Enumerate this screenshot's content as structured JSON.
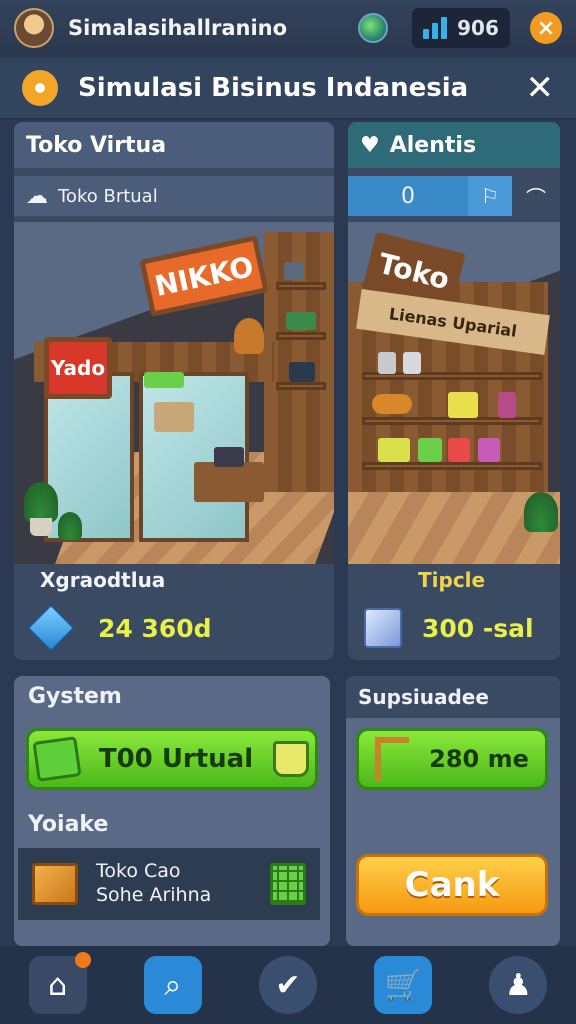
{
  "app": {
    "name": "Simalasihallranino",
    "stat_value": "906"
  },
  "titlebar": {
    "title": "Simulasi Bisinus Indanesia"
  },
  "left_panel": {
    "header": "Toko Virtua",
    "sub_label": "Toko Brtual",
    "sign_text": "NIKKO",
    "side_sign_text": "Yado",
    "caption": "Xgraodtlua",
    "value": "24 360d"
  },
  "right_panel": {
    "header": "Alentis",
    "counter": "0",
    "sign_top": "Toko",
    "sign_sub": "Lienas Uparial",
    "caption": "Tipcle",
    "value": "300 -sal"
  },
  "system_panel": {
    "header": "Gystem",
    "button_label": "T00 Urtual",
    "section_label": "Yoiake",
    "list_item_line1": "Toko Cao",
    "list_item_line2": "Sohe Arihna"
  },
  "supply_panel": {
    "header": "Supsiuadee",
    "button_label": "280 me",
    "action_label": "Cank"
  },
  "colors": {
    "accent_green": "#5ec82a",
    "accent_orange": "#f5a015",
    "panel_bg": "#3a4a63"
  }
}
